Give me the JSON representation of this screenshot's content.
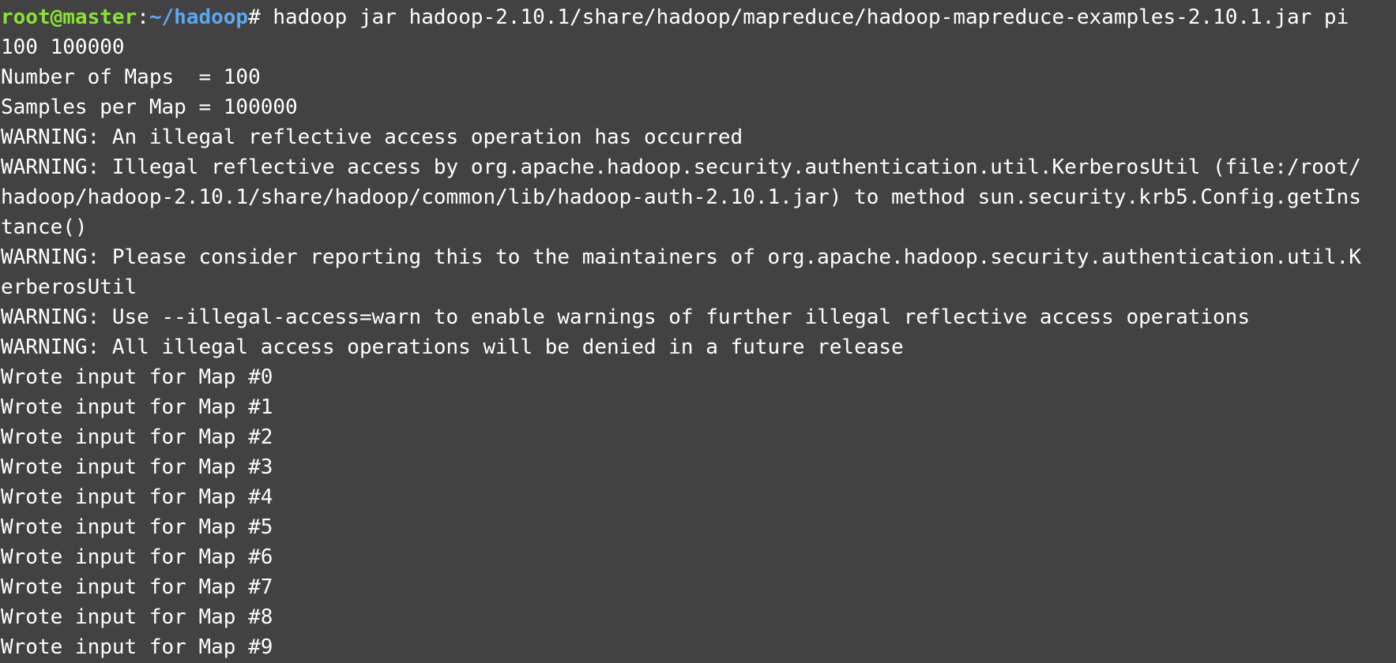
{
  "prompt": {
    "user_host": "root@master",
    "separator": ":",
    "path": "~/hadoop",
    "symbol": "# ",
    "command": "hadoop jar hadoop-2.10.1/share/hadoop/mapreduce/hadoop-mapreduce-examples-2.10.1.jar pi"
  },
  "colors": {
    "background": "#424242",
    "text": "#ffffff",
    "prompt_user": "#8ae234",
    "prompt_path": "#5aa8f2"
  },
  "output_lines": [
    "100 100000",
    "Number of Maps  = 100",
    "Samples per Map = 100000",
    "WARNING: An illegal reflective access operation has occurred",
    "WARNING: Illegal reflective access by org.apache.hadoop.security.authentication.util.KerberosUtil (file:/root/",
    "hadoop/hadoop-2.10.1/share/hadoop/common/lib/hadoop-auth-2.10.1.jar) to method sun.security.krb5.Config.getIns",
    "tance()",
    "WARNING: Please consider reporting this to the maintainers of org.apache.hadoop.security.authentication.util.K",
    "erberosUtil",
    "WARNING: Use --illegal-access=warn to enable warnings of further illegal reflective access operations",
    "WARNING: All illegal access operations will be denied in a future release",
    "Wrote input for Map #0",
    "Wrote input for Map #1",
    "Wrote input for Map #2",
    "Wrote input for Map #3",
    "Wrote input for Map #4",
    "Wrote input for Map #5",
    "Wrote input for Map #6",
    "Wrote input for Map #7",
    "Wrote input for Map #8",
    "Wrote input for Map #9"
  ]
}
